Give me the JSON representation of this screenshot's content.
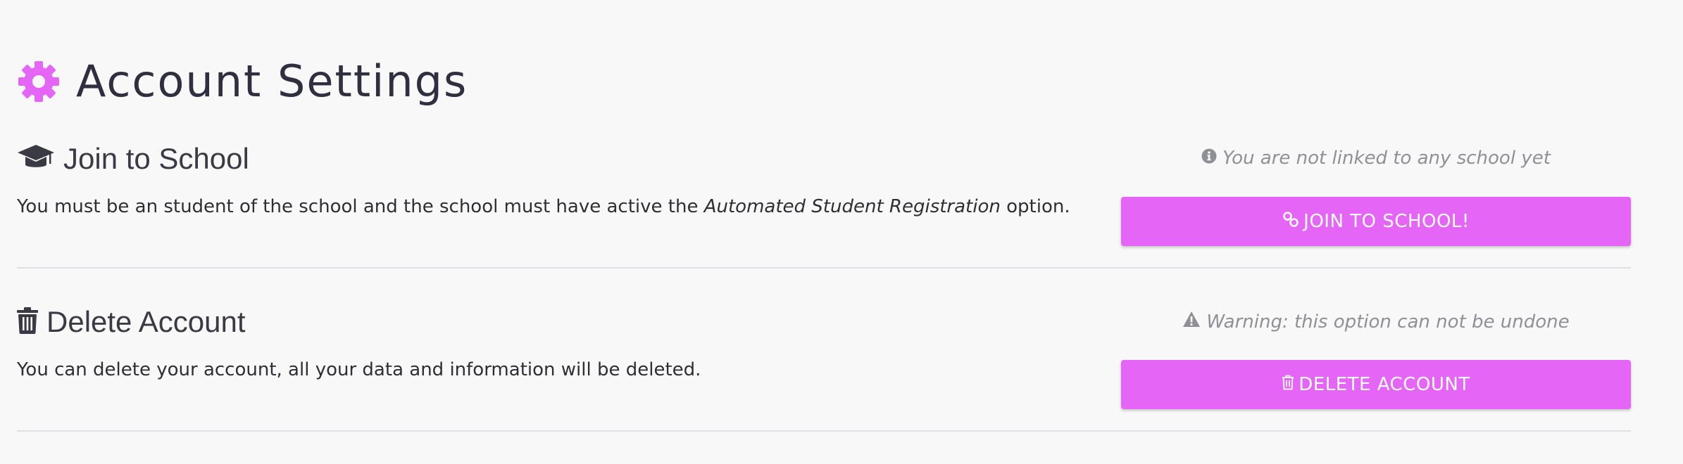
{
  "header": {
    "title": "Account Settings",
    "icon": "gear-icon",
    "accent_color": "#e565f7"
  },
  "sections": {
    "join": {
      "icon": "graduation-cap-icon",
      "title": "Join to School",
      "description_prefix": "You must be an student of the school and the school must have active the ",
      "description_emphasis": "Automated Student Registration",
      "description_suffix": " option.",
      "note_icon": "info-circle-icon",
      "note": "You are not linked to any school yet",
      "button_icon": "link-icon",
      "button_label": "JOIN TO SCHOOL!"
    },
    "delete": {
      "icon": "trash-icon",
      "title": "Delete Account",
      "description": "You can delete your account, all your data and information will be deleted.",
      "note_icon": "warning-triangle-icon",
      "note": "Warning: this option can not be undone",
      "button_icon": "trash-icon",
      "button_label": "DELETE ACCOUNT"
    }
  },
  "colors": {
    "button_bg": "#e565f7",
    "button_text": "#ffffff",
    "note_text": "#8f8f96",
    "divider": "#e0e0e4"
  }
}
